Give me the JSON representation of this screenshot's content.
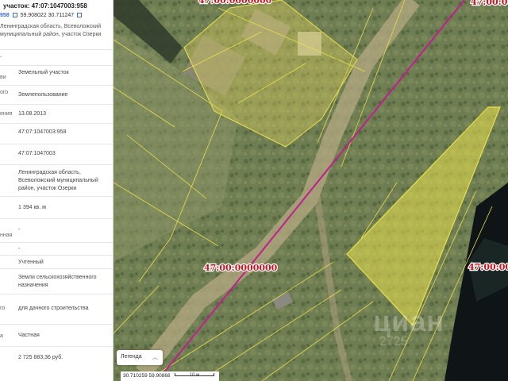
{
  "panel": {
    "title": "участок: 47:07:1047003:958",
    "id_short": "958",
    "coords": "59.908022 30.711247",
    "address": "Ленинградская область, Всеволожский муниципальный район, участок Озерки",
    "rows": [
      {
        "label": "-",
        "value": ""
      },
      {
        "label": "ви",
        "value": "Земельный участок"
      },
      {
        "label": "ого",
        "value": "Землепользование"
      },
      {
        "label": "ения",
        "value": "13.08.2013"
      },
      {
        "label": "",
        "value": "47:07:1047003:958"
      },
      {
        "label": "",
        "value": "47:07:1047003"
      },
      {
        "label": "",
        "value": "Ленинградская область, Всеволожский муниципальный район, участок Озерки"
      },
      {
        "label": "",
        "value": "1 394 кв. м"
      },
      {
        "label": "нная",
        "value": "-"
      },
      {
        "label": "",
        "value": "-"
      },
      {
        "label": "",
        "value": "Учтенный"
      },
      {
        "label": "",
        "value": "Земли сельскохозяйственного назначения"
      },
      {
        "label": "го",
        "value": "для дачного строительства"
      },
      {
        "label": "а",
        "value": "Частная"
      },
      {
        "label": "",
        "value": "2 725 883,36 руб."
      }
    ]
  },
  "map": {
    "boundary_label": "47:00:0000000",
    "legend_label": "Легенда",
    "coords": "30.710259 59.908687",
    "scale_label": "10 м",
    "watermark": "циан",
    "watermark_id": "2725"
  }
}
